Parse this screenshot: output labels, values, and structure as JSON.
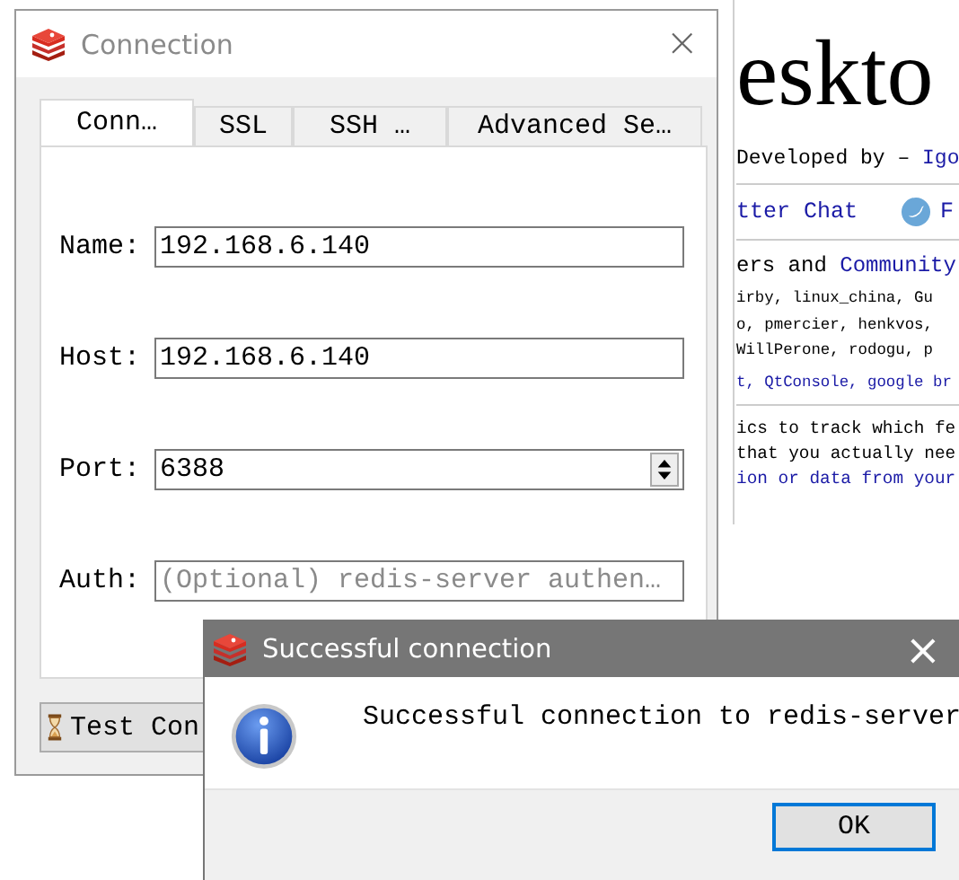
{
  "background_page": {
    "heading": "eskto",
    "byline": "Developed by –",
    "byline_link": "Igo",
    "social": [
      {
        "label": "tter Chat"
      },
      {
        "label": "F"
      }
    ],
    "contributors_title": "ers and",
    "contributors_link": "Community",
    "contributor_lines": [
      {
        "text": "irby, linux_china, Gu",
        "kind": "plain"
      },
      {
        "text": "o, pmercier, henkvos,",
        "kind": "plain"
      },
      {
        "text": "WillPerone, rodogu, p",
        "kind": "plain"
      },
      {
        "text": "t, QtConsole, google br",
        "kind": "link"
      }
    ],
    "info_lines": [
      {
        "text": "ics to track which fe",
        "kind": "plain"
      },
      {
        "text": "that you actually nee",
        "kind": "plain"
      },
      {
        "text": "ion or data from your",
        "kind": "link"
      }
    ]
  },
  "connection_window": {
    "title": "Connection",
    "close": "×",
    "tabs": [
      {
        "label": "Conn…",
        "selected": true
      },
      {
        "label": "SSL",
        "selected": false
      },
      {
        "label": "SSH …",
        "selected": false
      },
      {
        "label": "Advanced Se…",
        "selected": false
      }
    ],
    "fields": [
      {
        "label": "Name:",
        "value": "192.168.6.140",
        "kind": "text"
      },
      {
        "label": "Host:",
        "value": "192.168.6.140",
        "kind": "text"
      },
      {
        "label": "Port:",
        "value": "6388",
        "kind": "spin"
      },
      {
        "label": "Auth:",
        "placeholder": "(Optional) redis-server authen…",
        "kind": "text"
      }
    ],
    "test_button": "Test Con"
  },
  "message_dialog": {
    "title": "Successful connection",
    "close": "×",
    "message": "Successful connection to redis-server",
    "button": "OK"
  }
}
